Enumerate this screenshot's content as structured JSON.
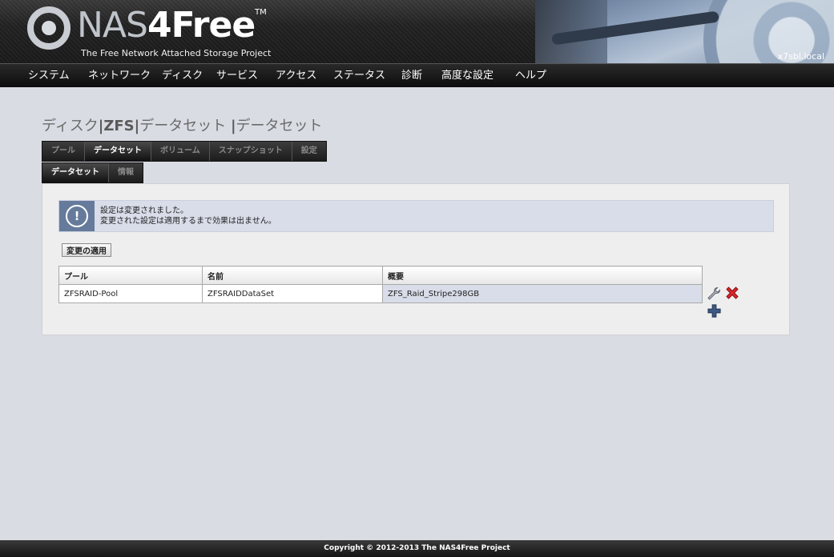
{
  "header": {
    "logo_main": "NAS",
    "logo_accent": "4Free",
    "trademark": "TM",
    "tagline": "The Free Network Attached Storage Project",
    "hostname": "x7sbl.local"
  },
  "nav": {
    "items": [
      {
        "label": "システム"
      },
      {
        "label": "ネットワーク"
      },
      {
        "label": "ディスク"
      },
      {
        "label": "サービス"
      },
      {
        "label": "アクセス"
      },
      {
        "label": "ステータス"
      },
      {
        "label": "診断"
      },
      {
        "label": "高度な設定"
      },
      {
        "label": "ヘルプ"
      }
    ]
  },
  "page_title": {
    "part1": "ディスク",
    "sep1": "|",
    "part2": "ZFS",
    "sep2": "|",
    "part3": "データセット",
    "sep3": "|",
    "part4": "データセット"
  },
  "tabs_primary": [
    {
      "label": "プール",
      "active": false
    },
    {
      "label": "データセット",
      "active": true
    },
    {
      "label": "ボリューム",
      "active": false
    },
    {
      "label": "スナップショット",
      "active": false
    },
    {
      "label": "設定",
      "active": false
    }
  ],
  "tabs_secondary": [
    {
      "label": "データセット",
      "active": true
    },
    {
      "label": "情報",
      "active": false
    }
  ],
  "notice": {
    "icon": "!",
    "line1": "設定は変更されました。",
    "line2": "変更された設定は適用するまで効果は出ません。"
  },
  "apply_button": "変更の適用",
  "table": {
    "headers": [
      "プール",
      "名前",
      "概要"
    ],
    "rows": [
      [
        "ZFSRAID-Pool",
        "ZFSRAIDDataSet",
        "ZFS_Raid_Stripe298GB"
      ]
    ]
  },
  "icons": {
    "edit": "wrench-icon",
    "delete": "delete-x-icon",
    "add": "plus-icon"
  },
  "colors": {
    "delete": "#d9262b",
    "add": "#3d5a86",
    "notice_icon_bg": "#667b9b"
  },
  "footer": "Copyright © 2012-2013 The NAS4Free Project"
}
